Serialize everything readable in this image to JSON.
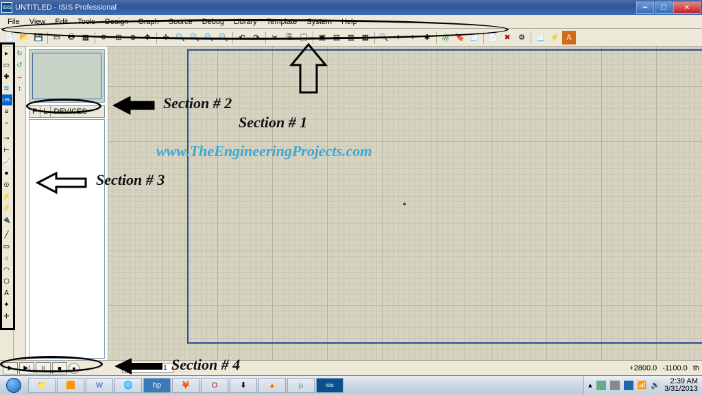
{
  "window": {
    "title": "UNTITLED - ISIS Professional",
    "icon_text": "ISIS"
  },
  "menu": [
    "File",
    "View",
    "Edit",
    "Tools",
    "Design",
    "Graph",
    "Source",
    "Debug",
    "Library",
    "Template",
    "System",
    "Help"
  ],
  "sidepanel": {
    "p_label": "P",
    "l_label": "L",
    "devices_label": "DEVICES"
  },
  "annotations": {
    "section1": "Section # 1",
    "section2": "Section # 2",
    "section3": "Section # 3",
    "section4": "Section # 4",
    "watermark": "www.TheEngineeringProjects.com"
  },
  "statusbar": {
    "sheet_tab": "Root sheet 1",
    "coord_x": "+2800.0",
    "coord_y": "-1100.0",
    "units": "th"
  },
  "taskbar": {
    "time": "2:39 AM",
    "date": "3/31/2013"
  }
}
